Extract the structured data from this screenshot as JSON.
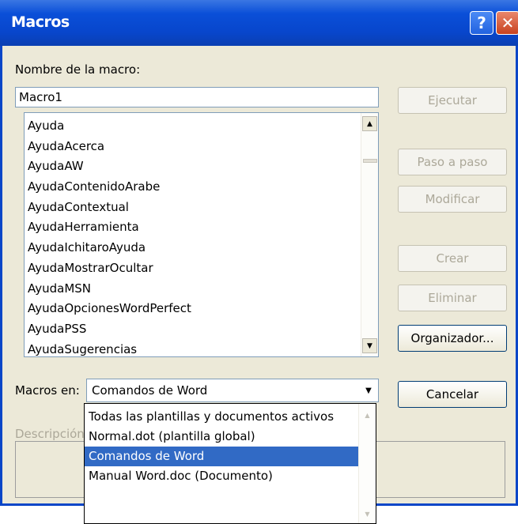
{
  "window": {
    "title": "Macros",
    "help_icon": "?",
    "close_icon": "✕"
  },
  "macro_name": {
    "label": "Nombre de la macro:",
    "value": "Macro1"
  },
  "macro_list": {
    "items": [
      "Ayuda",
      "AyudaAcerca",
      "AyudaAW",
      "AyudaContenidoArabe",
      "AyudaContextual",
      "AyudaHerramienta",
      "AyudaIchitaroAyuda",
      "AyudaMostrarOcultar",
      "AyudaMSN",
      "AyudaOpcionesWordPerfect",
      "AyudaPSS",
      "AyudaSugerencias"
    ],
    "scroll_up": "▲",
    "scroll_down": "▼"
  },
  "buttons": {
    "run": "Ejecutar",
    "step": "Paso a paso",
    "edit": "Modificar",
    "create": "Crear",
    "delete": "Eliminar",
    "organizer": "Organizador...",
    "cancel": "Cancelar"
  },
  "macros_in": {
    "label": "Macros en:",
    "value": "Comandos de Word",
    "arrow": "▼",
    "options": [
      "Todas las plantillas y documentos activos",
      "Normal.dot (plantilla global)",
      "Comandos de Word",
      "Manual Word.doc (Documento)"
    ],
    "selected_index": 2
  },
  "description": {
    "label": "Descripción:"
  },
  "colors": {
    "titlebar": "#0a4fd8",
    "dialog_bg": "#ece9d8",
    "selection": "#316ac5",
    "disabled_text": "#aca899"
  }
}
